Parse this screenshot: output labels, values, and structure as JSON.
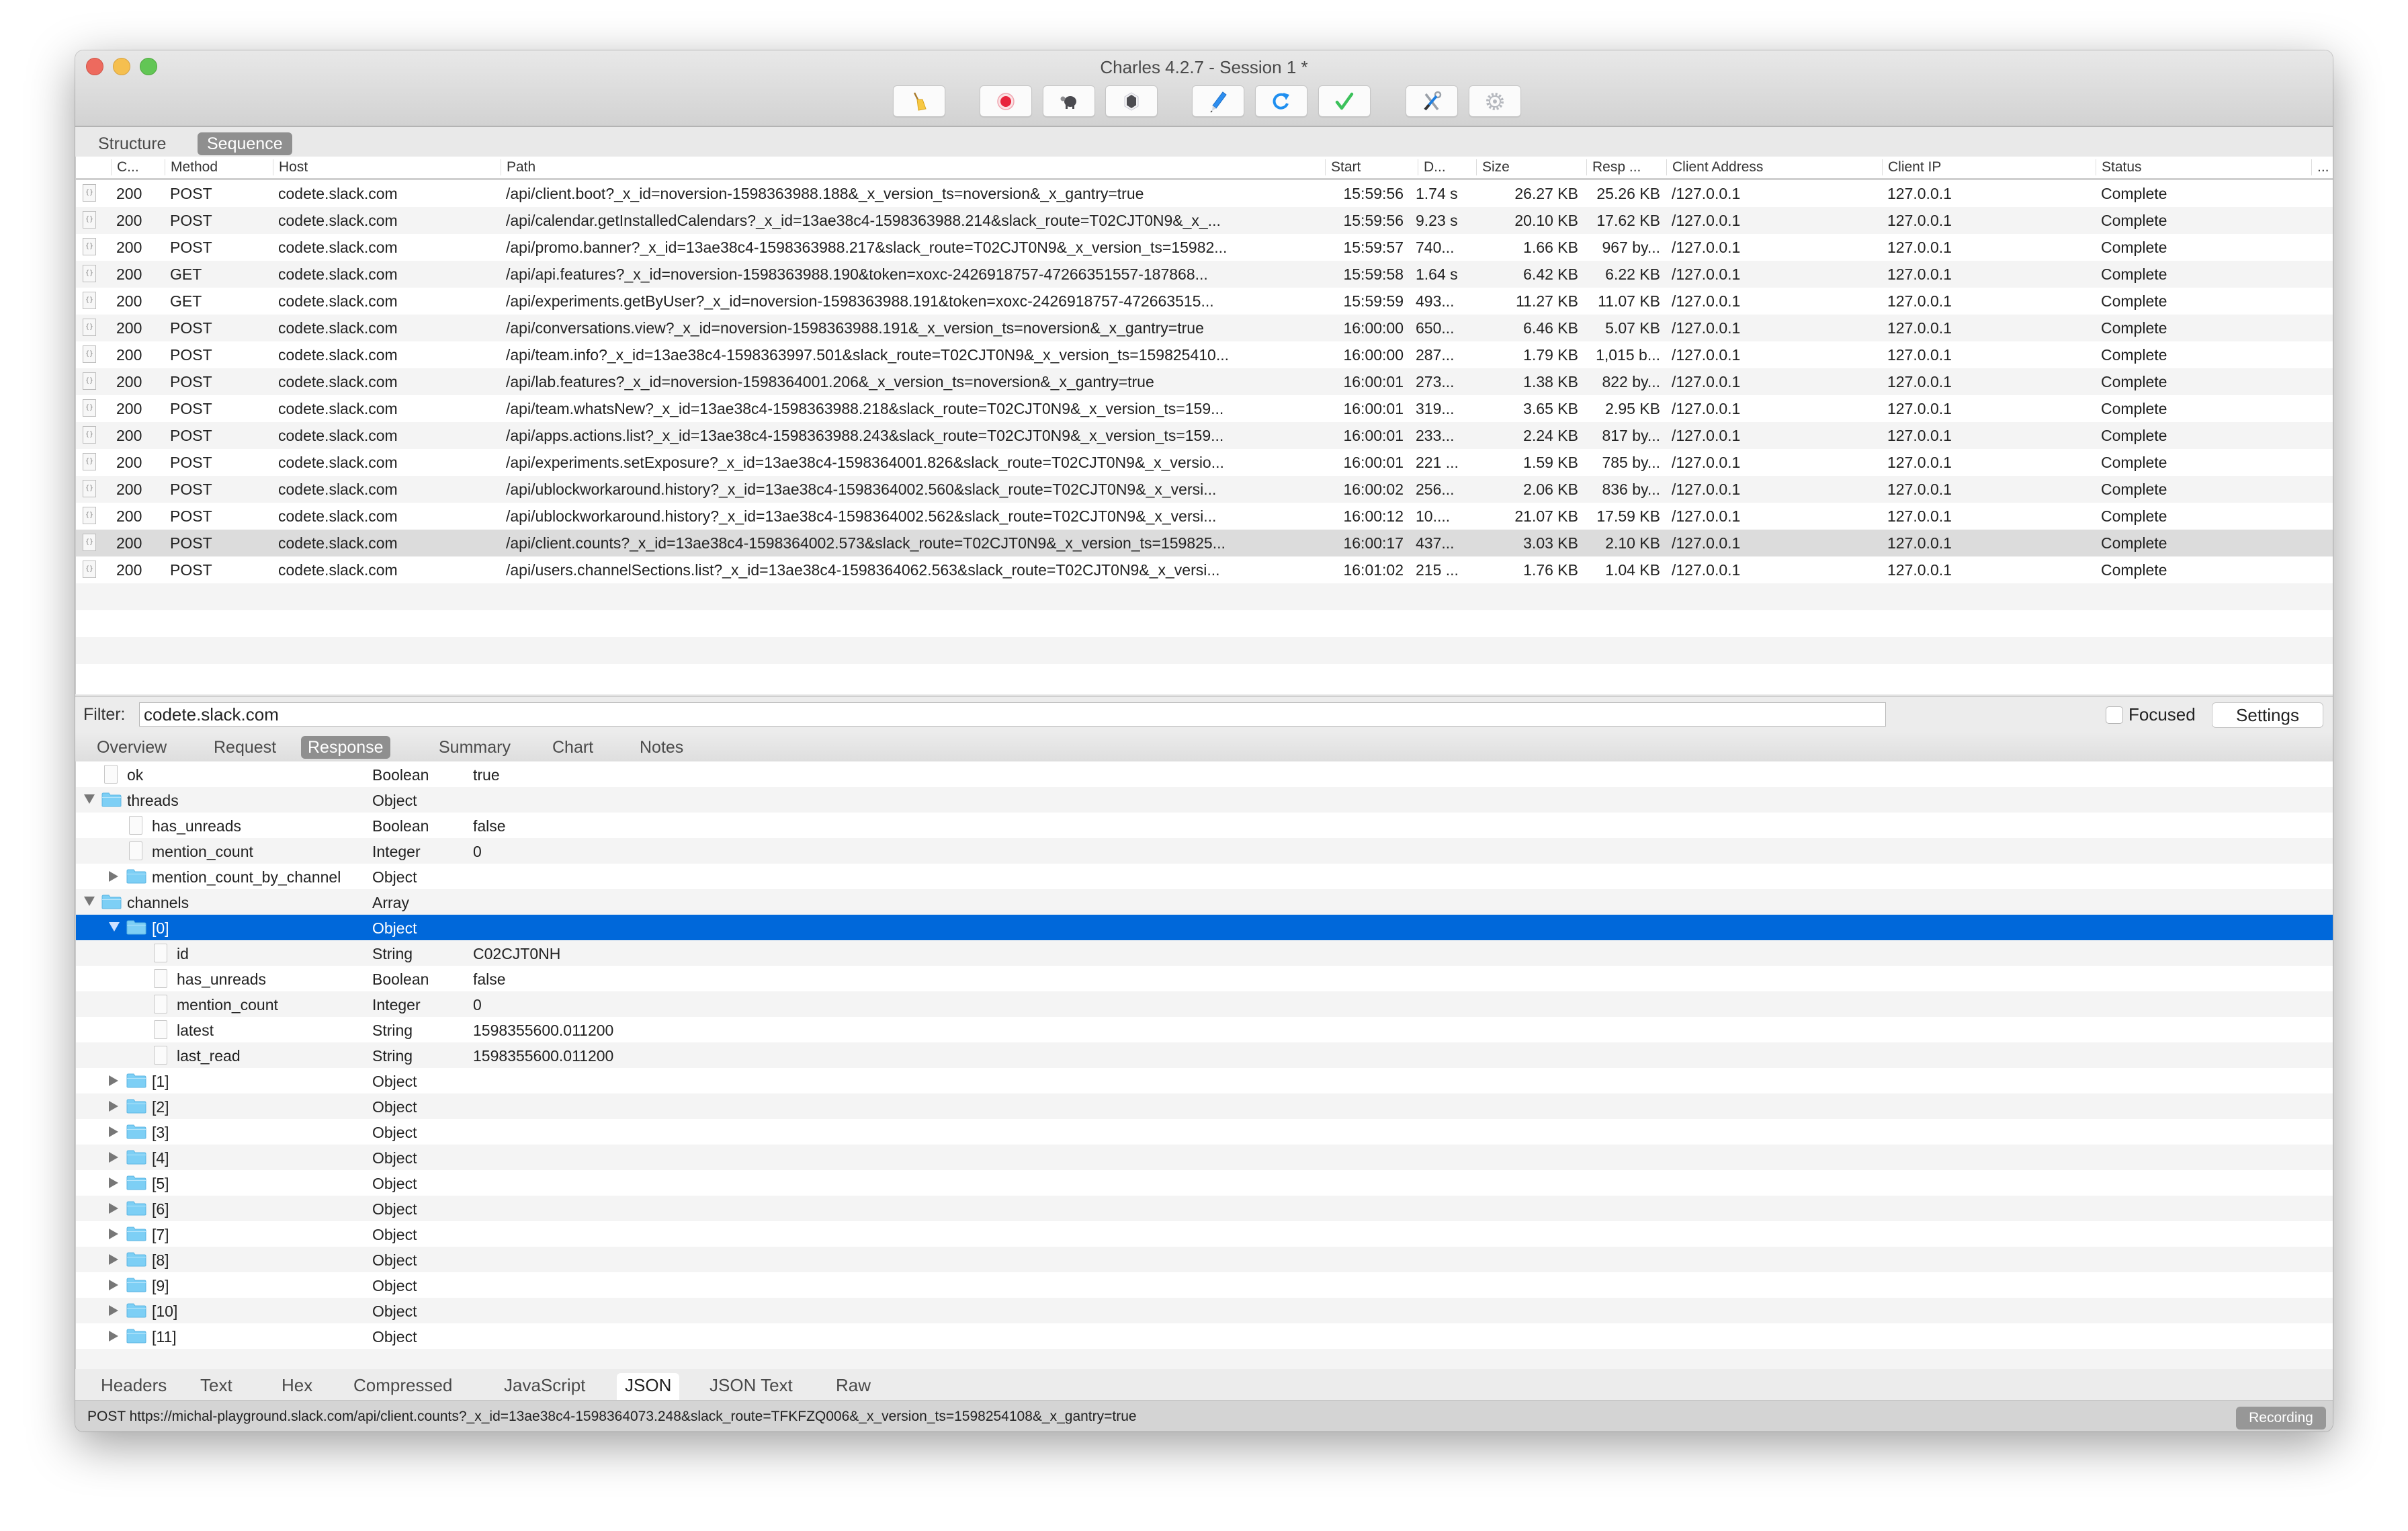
{
  "window": {
    "title": "Charles 4.2.7 - Session 1 *"
  },
  "toolbar": [
    {
      "name": "broom-icon",
      "label": "Clear session"
    },
    {
      "name": "record-icon",
      "label": "Record"
    },
    {
      "name": "turtle-icon",
      "label": "Throttle"
    },
    {
      "name": "stop-hexagon-icon",
      "label": "Breakpoints"
    },
    {
      "name": "pen-icon",
      "label": "Compose"
    },
    {
      "name": "refresh-icon",
      "label": "Repeat"
    },
    {
      "name": "checkmark-icon",
      "label": "Validate"
    },
    {
      "name": "tools-icon",
      "label": "Tools"
    },
    {
      "name": "gear-icon",
      "label": "Settings"
    }
  ],
  "view_tabs": [
    {
      "label": "Structure",
      "active": false
    },
    {
      "label": "Sequence",
      "active": true
    }
  ],
  "table": {
    "columns": [
      "C...",
      "Method",
      "Host",
      "Path",
      "Start",
      "D...",
      "Size",
      "Resp ...",
      "Client Address",
      "Client IP",
      "Status",
      "..."
    ],
    "rows": [
      {
        "code": "200",
        "method": "POST",
        "host": "codete.slack.com",
        "path": "/api/client.boot?_x_id=noversion-1598363988.188&_x_version_ts=noversion&_x_gantry=true",
        "start": "15:59:56",
        "duration": "1.74 s",
        "size": "26.27 KB",
        "resp": "25.26 KB",
        "client_address": "/127.0.0.1",
        "client_ip": "127.0.0.1",
        "status": "Complete"
      },
      {
        "code": "200",
        "method": "POST",
        "host": "codete.slack.com",
        "path": "/api/calendar.getInstalledCalendars?_x_id=13ae38c4-1598363988.214&slack_route=T02CJT0N9&_x_...",
        "start": "15:59:56",
        "duration": "9.23 s",
        "size": "20.10 KB",
        "resp": "17.62 KB",
        "client_address": "/127.0.0.1",
        "client_ip": "127.0.0.1",
        "status": "Complete"
      },
      {
        "code": "200",
        "method": "POST",
        "host": "codete.slack.com",
        "path": "/api/promo.banner?_x_id=13ae38c4-1598363988.217&slack_route=T02CJT0N9&_x_version_ts=15982...",
        "start": "15:59:57",
        "duration": "740...",
        "size": "1.66 KB",
        "resp": "967 by...",
        "client_address": "/127.0.0.1",
        "client_ip": "127.0.0.1",
        "status": "Complete"
      },
      {
        "code": "200",
        "method": "GET",
        "host": "codete.slack.com",
        "path": "/api/api.features?_x_id=noversion-1598363988.190&token=xoxc-2426918757-47266351557-187868...",
        "start": "15:59:58",
        "duration": "1.64 s",
        "size": "6.42 KB",
        "resp": "6.22 KB",
        "client_address": "/127.0.0.1",
        "client_ip": "127.0.0.1",
        "status": "Complete"
      },
      {
        "code": "200",
        "method": "GET",
        "host": "codete.slack.com",
        "path": "/api/experiments.getByUser?_x_id=noversion-1598363988.191&token=xoxc-2426918757-472663515...",
        "start": "15:59:59",
        "duration": "493...",
        "size": "11.27 KB",
        "resp": "11.07 KB",
        "client_address": "/127.0.0.1",
        "client_ip": "127.0.0.1",
        "status": "Complete"
      },
      {
        "code": "200",
        "method": "POST",
        "host": "codete.slack.com",
        "path": "/api/conversations.view?_x_id=noversion-1598363988.191&_x_version_ts=noversion&_x_gantry=true",
        "start": "16:00:00",
        "duration": "650...",
        "size": "6.46 KB",
        "resp": "5.07 KB",
        "client_address": "/127.0.0.1",
        "client_ip": "127.0.0.1",
        "status": "Complete"
      },
      {
        "code": "200",
        "method": "POST",
        "host": "codete.slack.com",
        "path": "/api/team.info?_x_id=13ae38c4-1598363997.501&slack_route=T02CJT0N9&_x_version_ts=159825410...",
        "start": "16:00:00",
        "duration": "287...",
        "size": "1.79 KB",
        "resp": "1,015 b...",
        "client_address": "/127.0.0.1",
        "client_ip": "127.0.0.1",
        "status": "Complete"
      },
      {
        "code": "200",
        "method": "POST",
        "host": "codete.slack.com",
        "path": "/api/lab.features?_x_id=noversion-1598364001.206&_x_version_ts=noversion&_x_gantry=true",
        "start": "16:00:01",
        "duration": "273...",
        "size": "1.38 KB",
        "resp": "822 by...",
        "client_address": "/127.0.0.1",
        "client_ip": "127.0.0.1",
        "status": "Complete"
      },
      {
        "code": "200",
        "method": "POST",
        "host": "codete.slack.com",
        "path": "/api/team.whatsNew?_x_id=13ae38c4-1598363988.218&slack_route=T02CJT0N9&_x_version_ts=159...",
        "start": "16:00:01",
        "duration": "319...",
        "size": "3.65 KB",
        "resp": "2.95 KB",
        "client_address": "/127.0.0.1",
        "client_ip": "127.0.0.1",
        "status": "Complete"
      },
      {
        "code": "200",
        "method": "POST",
        "host": "codete.slack.com",
        "path": "/api/apps.actions.list?_x_id=13ae38c4-1598363988.243&slack_route=T02CJT0N9&_x_version_ts=159...",
        "start": "16:00:01",
        "duration": "233...",
        "size": "2.24 KB",
        "resp": "817 by...",
        "client_address": "/127.0.0.1",
        "client_ip": "127.0.0.1",
        "status": "Complete"
      },
      {
        "code": "200",
        "method": "POST",
        "host": "codete.slack.com",
        "path": "/api/experiments.setExposure?_x_id=13ae38c4-1598364001.826&slack_route=T02CJT0N9&_x_versio...",
        "start": "16:00:01",
        "duration": "221 ...",
        "size": "1.59 KB",
        "resp": "785 by...",
        "client_address": "/127.0.0.1",
        "client_ip": "127.0.0.1",
        "status": "Complete"
      },
      {
        "code": "200",
        "method": "POST",
        "host": "codete.slack.com",
        "path": "/api/ublockworkaround.history?_x_id=13ae38c4-1598364002.560&slack_route=T02CJT0N9&_x_versi...",
        "start": "16:00:02",
        "duration": "256...",
        "size": "2.06 KB",
        "resp": "836 by...",
        "client_address": "/127.0.0.1",
        "client_ip": "127.0.0.1",
        "status": "Complete"
      },
      {
        "code": "200",
        "method": "POST",
        "host": "codete.slack.com",
        "path": "/api/ublockworkaround.history?_x_id=13ae38c4-1598364002.562&slack_route=T02CJT0N9&_x_versi...",
        "start": "16:00:12",
        "duration": "10....",
        "size": "21.07 KB",
        "resp": "17.59 KB",
        "client_address": "/127.0.0.1",
        "client_ip": "127.0.0.1",
        "status": "Complete"
      },
      {
        "code": "200",
        "method": "POST",
        "host": "codete.slack.com",
        "path": "/api/client.counts?_x_id=13ae38c4-1598364002.573&slack_route=T02CJT0N9&_x_version_ts=159825...",
        "start": "16:00:17",
        "duration": "437...",
        "size": "3.03 KB",
        "resp": "2.10 KB",
        "client_address": "/127.0.0.1",
        "client_ip": "127.0.0.1",
        "status": "Complete",
        "selected": true
      },
      {
        "code": "200",
        "method": "POST",
        "host": "codete.slack.com",
        "path": "/api/users.channelSections.list?_x_id=13ae38c4-1598364062.563&slack_route=T02CJT0N9&_x_versi...",
        "start": "16:01:02",
        "duration": "215 ...",
        "size": "1.76 KB",
        "resp": "1.04 KB",
        "client_address": "/127.0.0.1",
        "client_ip": "127.0.0.1",
        "status": "Complete"
      }
    ]
  },
  "filter": {
    "label": "Filter:",
    "value": "codete.slack.com",
    "focused_label": "Focused",
    "focused_checked": false,
    "settings_label": "Settings"
  },
  "detail_tabs": [
    {
      "label": "Overview",
      "active": false
    },
    {
      "label": "Request",
      "active": false
    },
    {
      "label": "Response",
      "active": true
    },
    {
      "label": "Summary",
      "active": false
    },
    {
      "label": "Chart",
      "active": false
    },
    {
      "label": "Notes",
      "active": false
    }
  ],
  "json_tree": [
    {
      "key": "ok",
      "type": "Boolean",
      "value": "true",
      "depth": 0,
      "kind": "leaf"
    },
    {
      "key": "threads",
      "type": "Object",
      "value": "",
      "depth": 0,
      "kind": "open"
    },
    {
      "key": "has_unreads",
      "type": "Boolean",
      "value": "false",
      "depth": 1,
      "kind": "leaf"
    },
    {
      "key": "mention_count",
      "type": "Integer",
      "value": "0",
      "depth": 1,
      "kind": "leaf"
    },
    {
      "key": "mention_count_by_channel",
      "type": "Object",
      "value": "",
      "depth": 1,
      "kind": "closed"
    },
    {
      "key": "channels",
      "type": "Array",
      "value": "",
      "depth": 0,
      "kind": "open"
    },
    {
      "key": "[0]",
      "type": "Object",
      "value": "",
      "depth": 1,
      "kind": "open",
      "selected": true
    },
    {
      "key": "id",
      "type": "String",
      "value": "C02CJT0NH",
      "depth": 2,
      "kind": "leaf"
    },
    {
      "key": "has_unreads",
      "type": "Boolean",
      "value": "false",
      "depth": 2,
      "kind": "leaf"
    },
    {
      "key": "mention_count",
      "type": "Integer",
      "value": "0",
      "depth": 2,
      "kind": "leaf"
    },
    {
      "key": "latest",
      "type": "String",
      "value": "1598355600.011200",
      "depth": 2,
      "kind": "leaf"
    },
    {
      "key": "last_read",
      "type": "String",
      "value": "1598355600.011200",
      "depth": 2,
      "kind": "leaf"
    },
    {
      "key": "[1]",
      "type": "Object",
      "value": "",
      "depth": 1,
      "kind": "closed"
    },
    {
      "key": "[2]",
      "type": "Object",
      "value": "",
      "depth": 1,
      "kind": "closed"
    },
    {
      "key": "[3]",
      "type": "Object",
      "value": "",
      "depth": 1,
      "kind": "closed"
    },
    {
      "key": "[4]",
      "type": "Object",
      "value": "",
      "depth": 1,
      "kind": "closed"
    },
    {
      "key": "[5]",
      "type": "Object",
      "value": "",
      "depth": 1,
      "kind": "closed"
    },
    {
      "key": "[6]",
      "type": "Object",
      "value": "",
      "depth": 1,
      "kind": "closed"
    },
    {
      "key": "[7]",
      "type": "Object",
      "value": "",
      "depth": 1,
      "kind": "closed"
    },
    {
      "key": "[8]",
      "type": "Object",
      "value": "",
      "depth": 1,
      "kind": "closed"
    },
    {
      "key": "[9]",
      "type": "Object",
      "value": "",
      "depth": 1,
      "kind": "closed"
    },
    {
      "key": "[10]",
      "type": "Object",
      "value": "",
      "depth": 1,
      "kind": "closed"
    },
    {
      "key": "[11]",
      "type": "Object",
      "value": "",
      "depth": 1,
      "kind": "closed"
    }
  ],
  "body_tabs": [
    {
      "label": "Headers",
      "active": false
    },
    {
      "label": "Text",
      "active": false
    },
    {
      "label": "Hex",
      "active": false
    },
    {
      "label": "Compressed",
      "active": false
    },
    {
      "label": "JavaScript",
      "active": false
    },
    {
      "label": "JSON",
      "active": true
    },
    {
      "label": "JSON Text",
      "active": false
    },
    {
      "label": "Raw",
      "active": false
    }
  ],
  "status": {
    "text": "POST https://michal-playground.slack.com/api/client.counts?_x_id=13ae38c4-1598364073.248&slack_route=TFKFZQ006&_x_version_ts=1598254108&_x_gantry=true",
    "recording_label": "Recording"
  },
  "colors": {
    "selection": "#0068da",
    "folder": "#7dcff5",
    "traffic_red": "#ed6a5e",
    "traffic_yellow": "#f5bf4f",
    "traffic_green": "#62c655"
  }
}
